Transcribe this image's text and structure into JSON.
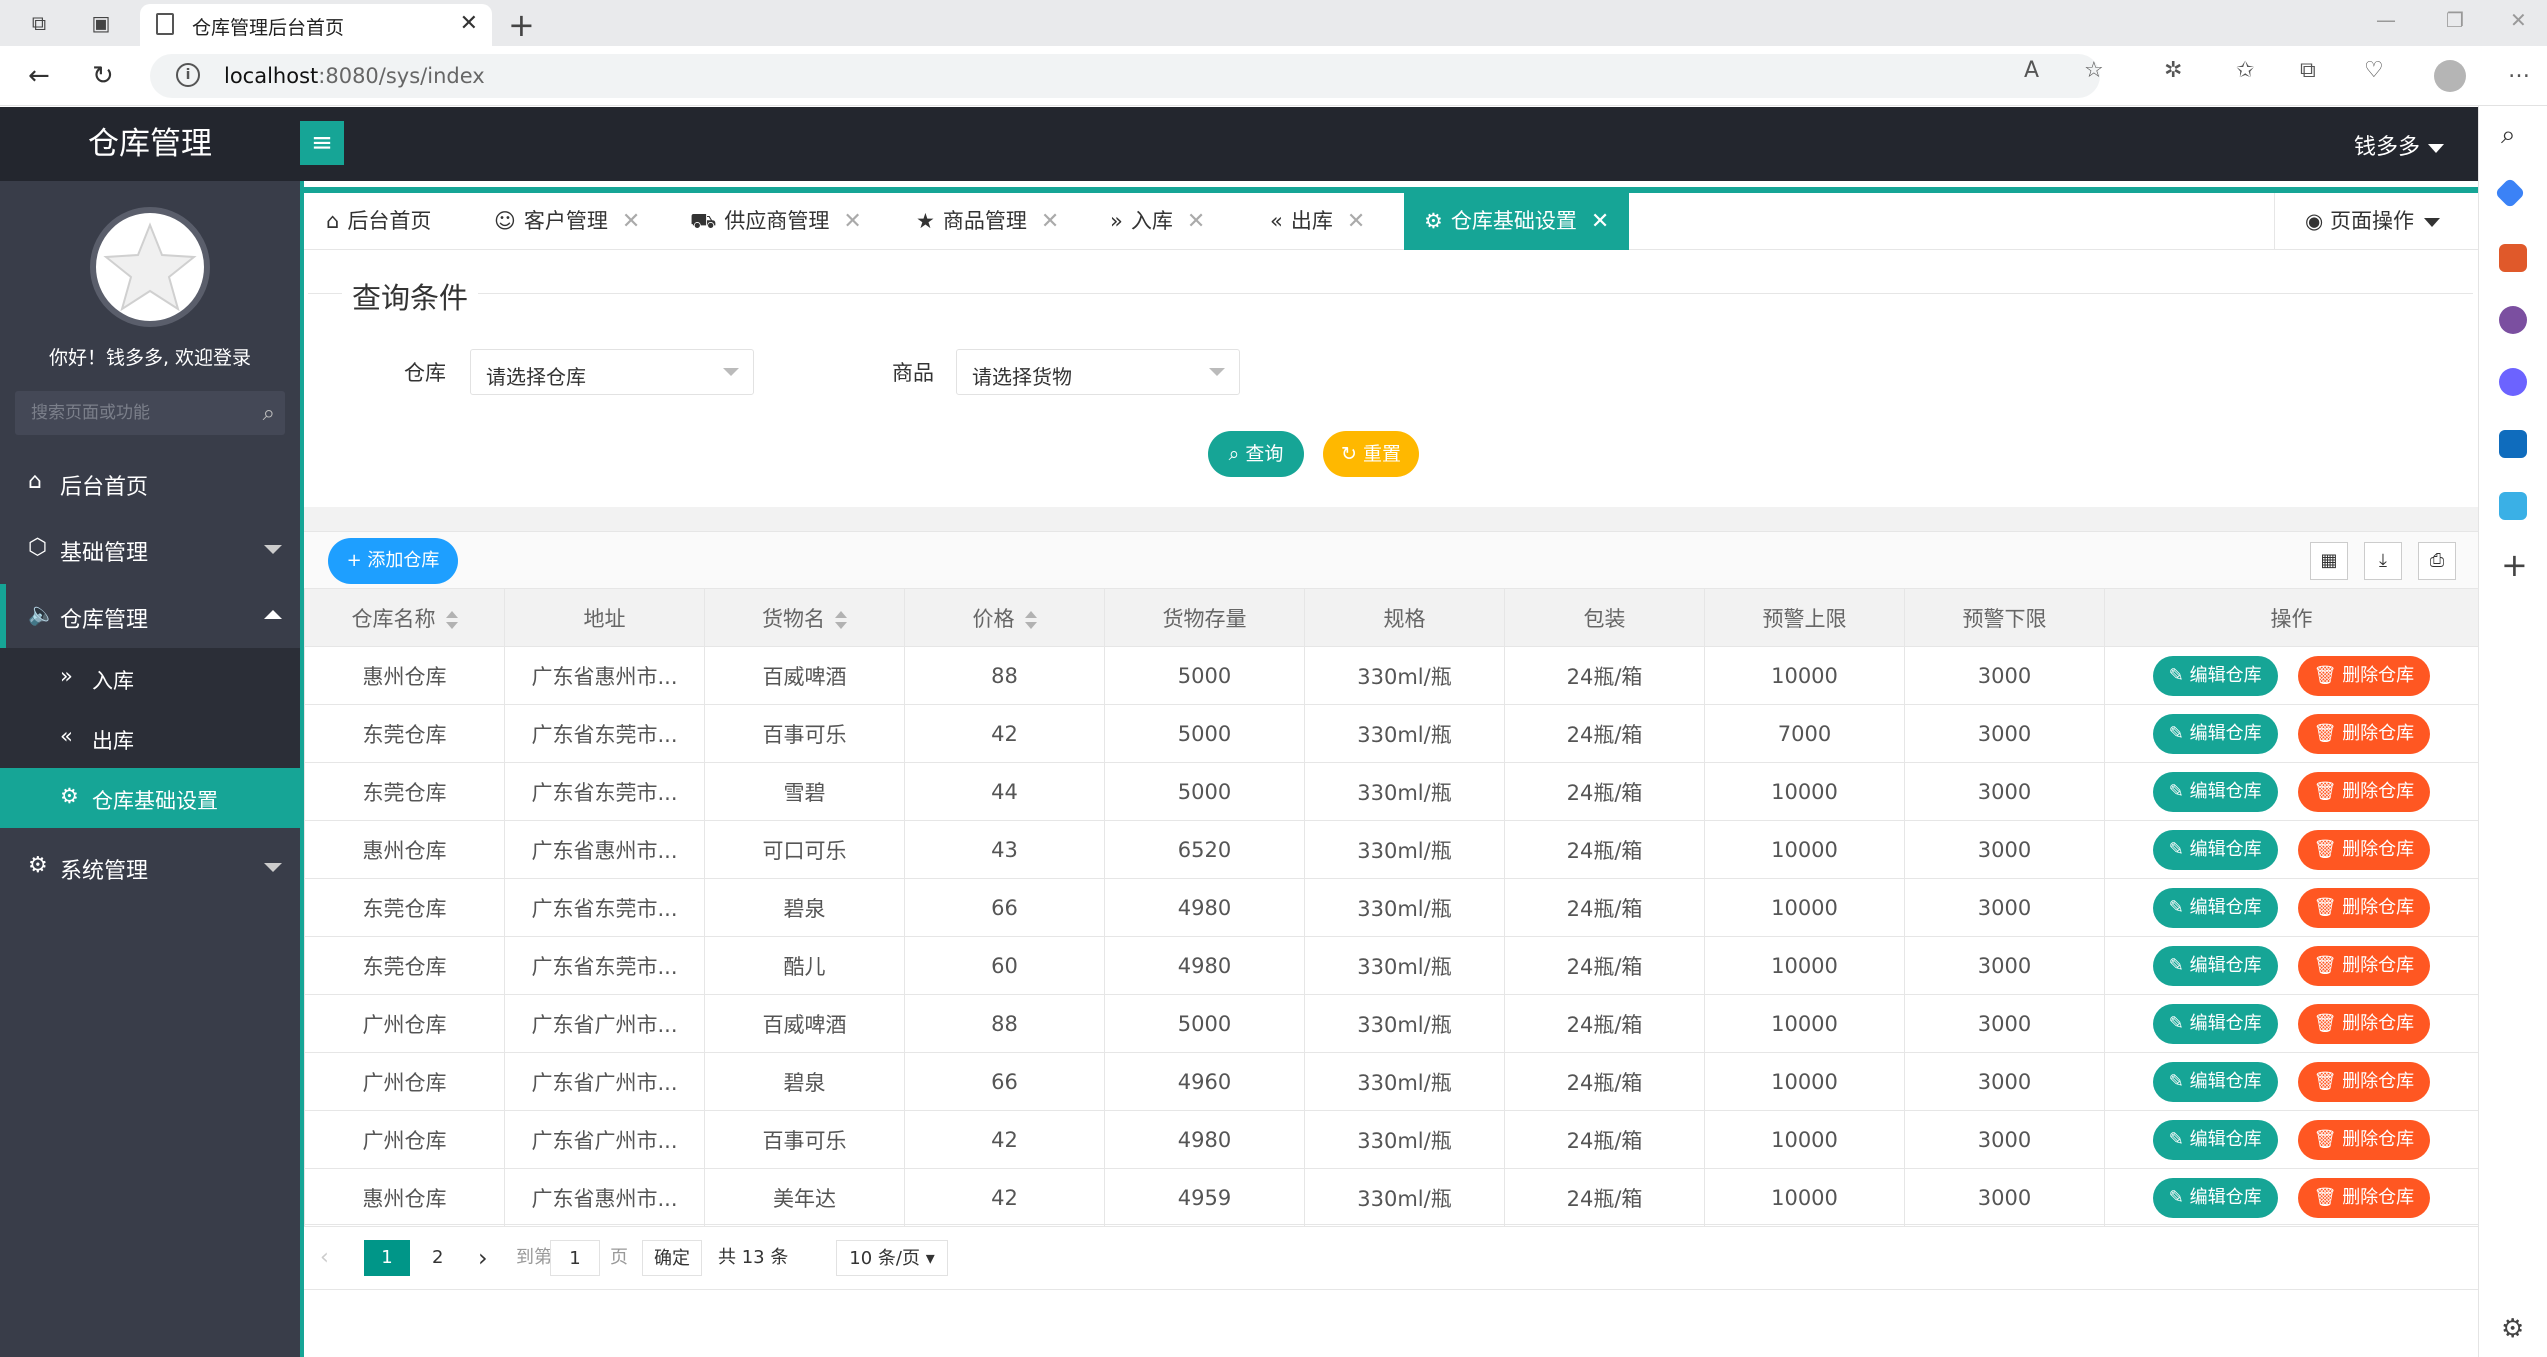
{
  "browser": {
    "tab_title": "仓库管理后台首页",
    "url_host": "localhost",
    "url_rest": ":8080/sys/index"
  },
  "header": {
    "logo": "仓库管理",
    "user": "钱多多"
  },
  "sidebar": {
    "welcome": "你好！钱多多, 欢迎登录",
    "search_placeholder": "搜索页面或功能",
    "items": [
      {
        "label": "后台首页"
      },
      {
        "label": "基础管理"
      },
      {
        "label": "仓库管理"
      },
      {
        "label": "系统管理"
      }
    ],
    "sub_items": [
      {
        "label": "入库"
      },
      {
        "label": "出库"
      },
      {
        "label": "仓库基础设置"
      }
    ]
  },
  "tabs": [
    {
      "label": "后台首页"
    },
    {
      "label": "客户管理"
    },
    {
      "label": "供应商管理"
    },
    {
      "label": "商品管理"
    },
    {
      "label": "入库"
    },
    {
      "label": "出库"
    },
    {
      "label": "仓库基础设置"
    }
  ],
  "page_ops": "页面操作",
  "query": {
    "title": "查询条件",
    "warehouse_label": "仓库",
    "warehouse_placeholder": "请选择仓库",
    "goods_label": "商品",
    "goods_placeholder": "请选择货物",
    "search_btn": "查询",
    "reset_btn": "重置"
  },
  "toolbar": {
    "add_btn": "添加仓库"
  },
  "table": {
    "headers": [
      "仓库名称",
      "地址",
      "货物名",
      "价格",
      "货物存量",
      "规格",
      "包装",
      "预警上限",
      "预警下限",
      "操作"
    ],
    "edit_label": "编辑仓库",
    "delete_label": "删除仓库",
    "rows": [
      [
        "惠州仓库",
        "广东省惠州市...",
        "百威啤酒",
        "88",
        "5000",
        "330ml/瓶",
        "24瓶/箱",
        "10000",
        "3000"
      ],
      [
        "东莞仓库",
        "广东省东莞市...",
        "百事可乐",
        "42",
        "5000",
        "330ml/瓶",
        "24瓶/箱",
        "7000",
        "3000"
      ],
      [
        "东莞仓库",
        "广东省东莞市...",
        "雪碧",
        "44",
        "5000",
        "330ml/瓶",
        "24瓶/箱",
        "10000",
        "3000"
      ],
      [
        "惠州仓库",
        "广东省惠州市...",
        "可口可乐",
        "43",
        "6520",
        "330ml/瓶",
        "24瓶/箱",
        "10000",
        "3000"
      ],
      [
        "东莞仓库",
        "广东省东莞市...",
        "碧泉",
        "66",
        "4980",
        "330ml/瓶",
        "24瓶/箱",
        "10000",
        "3000"
      ],
      [
        "东莞仓库",
        "广东省东莞市...",
        "酷儿",
        "60",
        "4980",
        "330ml/瓶",
        "24瓶/箱",
        "10000",
        "3000"
      ],
      [
        "广州仓库",
        "广东省广州市...",
        "百威啤酒",
        "88",
        "5000",
        "330ml/瓶",
        "24瓶/箱",
        "10000",
        "3000"
      ],
      [
        "广州仓库",
        "广东省广州市...",
        "碧泉",
        "66",
        "4960",
        "330ml/瓶",
        "24瓶/箱",
        "10000",
        "3000"
      ],
      [
        "广州仓库",
        "广东省广州市...",
        "百事可乐",
        "42",
        "4980",
        "330ml/瓶",
        "24瓶/箱",
        "10000",
        "3000"
      ],
      [
        "惠州仓库",
        "广东省惠州市...",
        "美年达",
        "42",
        "4959",
        "330ml/瓶",
        "24瓶/箱",
        "10000",
        "3000"
      ]
    ]
  },
  "pager": {
    "current": "1",
    "next_page": "2",
    "goto_label": "到第",
    "goto_value": "1",
    "page_unit": "页",
    "confirm": "确定",
    "total": "共 13 条",
    "page_size": "10 条/页"
  },
  "colors": {
    "primary": "#16a596",
    "header": "#23262e",
    "sidebar": "#393d49",
    "warn": "#ffb800",
    "danger": "#ff5722",
    "blue": "#1e9fff"
  }
}
